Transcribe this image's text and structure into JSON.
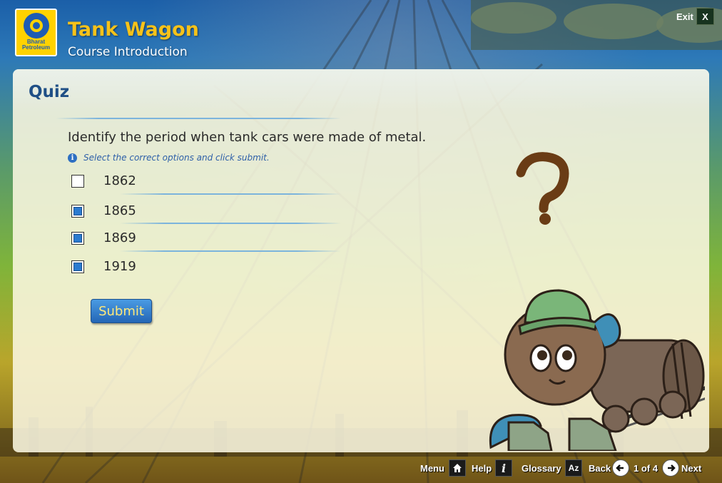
{
  "header": {
    "logo_text_line1": "Bharat",
    "logo_text_line2": "Petroleum",
    "title": "Tank Wagon",
    "subtitle": "Course Introduction",
    "exit_label": "Exit",
    "exit_button": "X"
  },
  "quiz": {
    "title": "Quiz",
    "question": "Identify the period when tank cars were made of metal.",
    "instruction": "Select the correct options and click submit.",
    "options": [
      {
        "label": "1862",
        "checked": false
      },
      {
        "label": "1865",
        "checked": true
      },
      {
        "label": "1869",
        "checked": true
      },
      {
        "label": "1919",
        "checked": true
      }
    ],
    "submit_label": "Submit"
  },
  "footer": {
    "menu_label": "Menu",
    "help_label": "Help",
    "glossary_label": "Glossary",
    "back_label": "Back",
    "page_indicator": "1 of 4",
    "next_label": "Next"
  },
  "colors": {
    "accent": "#2466b6",
    "title_gold": "#f6c21a",
    "quiz_title": "#1f4f86"
  }
}
